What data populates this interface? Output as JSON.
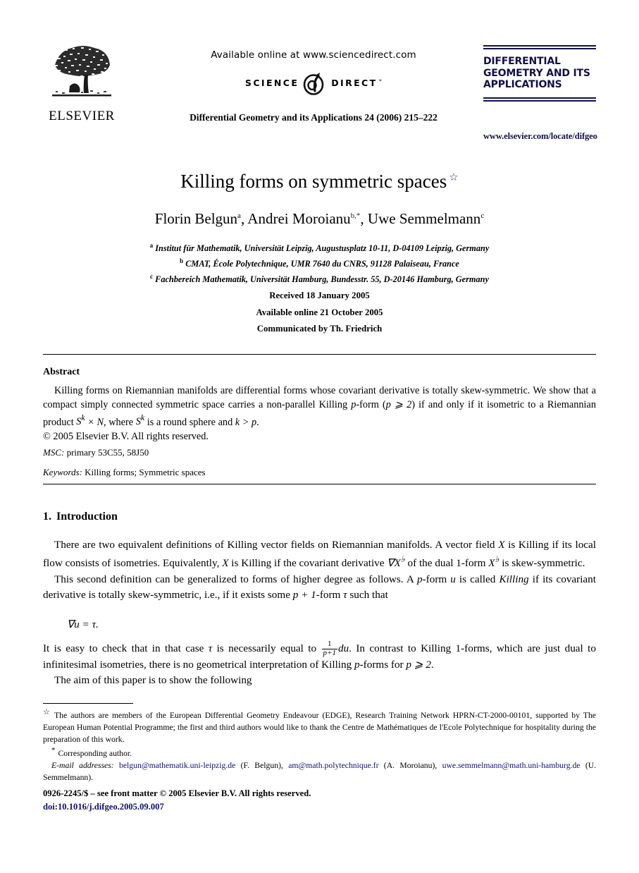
{
  "header": {
    "publisher_logo_text": "ELSEVIER",
    "available_online": "Available online at www.sciencedirect.com",
    "sciencedirect_left": "SCIENCE",
    "sciencedirect_right": "DIRECT",
    "sciencedirect_tm": "°",
    "journal_reference": "Differential Geometry and its Applications 24 (2006) 215–222",
    "journal_logo_line1": "DIFFERENTIAL",
    "journal_logo_line2": "GEOMETRY AND ITS",
    "journal_logo_line3": "APPLICATIONS",
    "journal_url": "www.elsevier.com/locate/difgeo",
    "logo_color": "#10104a"
  },
  "article": {
    "title": "Killing forms on symmetric spaces",
    "title_footnote_marker": "☆",
    "authors_plain": "Florin Belgun a, Andrei Moroianu b,*, Uwe Semmelmann c",
    "authors": [
      {
        "name": "Florin Belgun",
        "marker": "a"
      },
      {
        "name": "Andrei Moroianu",
        "marker": "b,*"
      },
      {
        "name": "Uwe Semmelmann",
        "marker": "c"
      }
    ],
    "affiliations": [
      {
        "marker": "a",
        "text": "Institut für Mathematik, Universität Leipzig, Augustusplatz 10-11, D-04109 Leipzig, Germany"
      },
      {
        "marker": "b",
        "text": "CMAT, École Polytechnique, UMR 7640 du CNRS, 91128 Palaiseau, France"
      },
      {
        "marker": "c",
        "text": "Fachbereich Mathematik, Universität Hamburg, Bundesstr. 55, D-20146 Hamburg, Germany"
      }
    ],
    "received": "Received 18 January 2005",
    "available_online": "Available online 21 October 2005",
    "communicated_by": "Communicated by Th. Friedrich"
  },
  "abstract": {
    "heading": "Abstract",
    "paragraph_1_a": "Killing forms on Riemannian manifolds are differential forms whose covariant derivative is totally skew-symmetric. We show that a compact simply connected symmetric space carries a non-parallel Killing ",
    "paragraph_1_p": "p",
    "paragraph_1_b": "-form (",
    "paragraph_1_cond": "p ⩾ 2",
    "paragraph_1_c": ") if and only if it isometric to a Riemannian product ",
    "paragraph_1_prod": "S",
    "paragraph_1_prod_sup": "k",
    "paragraph_1_prod_rest": " × N",
    "paragraph_1_d": ", where ",
    "paragraph_1_e": " is a round sphere and ",
    "paragraph_1_kgp": "k > p",
    "paragraph_1_f": ".",
    "copyright_line": "© 2005 Elsevier B.V. All rights reserved.",
    "msc_label": "MSC:",
    "msc_value": "primary 53C55, 58J50",
    "keywords_label": "Keywords:",
    "keywords_value": "Killing forms; Symmetric spaces"
  },
  "introduction": {
    "number": "1.",
    "heading": "Introduction",
    "para1_a": "There are two equivalent definitions of Killing vector fields on Riemannian manifolds. A vector field ",
    "para1_X1": "X",
    "para1_b": " is Killing if its local flow consists of isometries. Equivalently, ",
    "para1_X2": "X",
    "para1_c": " is Killing if the covariant derivative ",
    "para1_nabla": "∇X",
    "para1_nabla_sup": "♭",
    "para1_d": " of the dual 1-form ",
    "para1_Xb": "X",
    "para1_Xb_sup": "♭",
    "para1_e": " is skew-symmetric.",
    "para2_a": "This second definition can be generalized to forms of higher degree as follows. A ",
    "para2_p": "p",
    "para2_b": "-form ",
    "para2_u": "u",
    "para2_c": " is called ",
    "para2_killing": "Killing",
    "para2_d": " if its covariant derivative is totally skew-symmetric, i.e., if it exists some ",
    "para2_pp1": "p + 1",
    "para2_e": "-form ",
    "para2_tau": "τ",
    "para2_f": " such that",
    "equation": "∇u = τ.",
    "para3_a": "It is easy to check that in that case ",
    "para3_tau": "τ",
    "para3_b": " is necessarily equal to ",
    "para3_frac_num": "1",
    "para3_frac_den": "p+1",
    "para3_du": "du",
    "para3_c": ". In contrast to Killing 1-forms, which are just dual to infinitesimal isometries, there is no geometrical interpretation of Killing ",
    "para3_p": "p",
    "para3_d": "-forms for ",
    "para3_cond": "p ⩾ 2",
    "para3_e": ".",
    "para4": "The aim of this paper is to show the following"
  },
  "footnotes": {
    "star_marker": "☆",
    "star_text": "The authors are members of the European Differential Geometry Endeavour (EDGE), Research Training Network HPRN-CT-2000-00101, supported by The European Human Potential Programme; the first and third authors would like to thank the Centre de Mathématiques de l'Ecole Polytechnique for hospitality during the preparation of this work.",
    "corresponding_marker": "*",
    "corresponding_text": "Corresponding author.",
    "email_label": "E-mail addresses:",
    "emails": [
      {
        "address": "belgun@mathematik.uni-leipzig.de",
        "owner": "(F. Belgun)"
      },
      {
        "address": "am@math.polytechnique.fr",
        "owner": "(A. Moroianu)"
      },
      {
        "address": "uwe.semmelmann@math.uni-hamburg.de",
        "owner": "(U. Semmelmann)"
      }
    ],
    "link_color": "#11116b"
  },
  "footer": {
    "issn_line": "0926-2245/$ – see front matter © 2005 Elsevier B.V. All rights reserved.",
    "doi": "doi:10.1016/j.difgeo.2005.09.007"
  }
}
